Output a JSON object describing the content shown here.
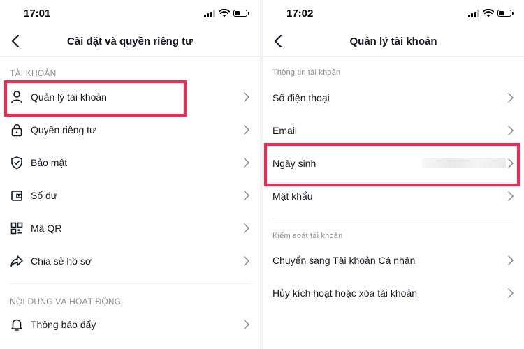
{
  "left": {
    "time": "17:01",
    "title": "Cài đặt và quyền riêng tư",
    "section_account": "TÀI KHOẢN",
    "items": [
      {
        "label": "Quản lý tài khoản",
        "icon": "person-icon"
      },
      {
        "label": "Quyền riêng tư",
        "icon": "lock-icon"
      },
      {
        "label": "Bảo mật",
        "icon": "shield-icon"
      },
      {
        "label": "Số dư",
        "icon": "wallet-icon"
      },
      {
        "label": "Mã QR",
        "icon": "qr-code-icon"
      },
      {
        "label": "Chia sẻ hồ sơ",
        "icon": "share-icon"
      }
    ],
    "section_content": "NỘI DUNG VÀ HOẠT ĐỘNG",
    "items2": [
      {
        "label": "Thông báo đẩy",
        "icon": "bell-icon"
      }
    ]
  },
  "right": {
    "time": "17:02",
    "title": "Quản lý tài khoản",
    "section_info": "Thông tin tài khoản",
    "items": [
      {
        "label": "Số điện thoại"
      },
      {
        "label": "Email"
      },
      {
        "label": "Ngày sinh"
      },
      {
        "label": "Mật khẩu"
      }
    ],
    "section_control": "Kiểm soát tài khoản",
    "items2": [
      {
        "label": "Chuyển sang Tài khoản Cá nhân"
      },
      {
        "label": "Hủy kích hoạt hoặc xóa tài khoản"
      }
    ]
  },
  "colors": {
    "highlight": "#ee2a4e",
    "section_text": "#8a8b91",
    "text": "#161823"
  }
}
